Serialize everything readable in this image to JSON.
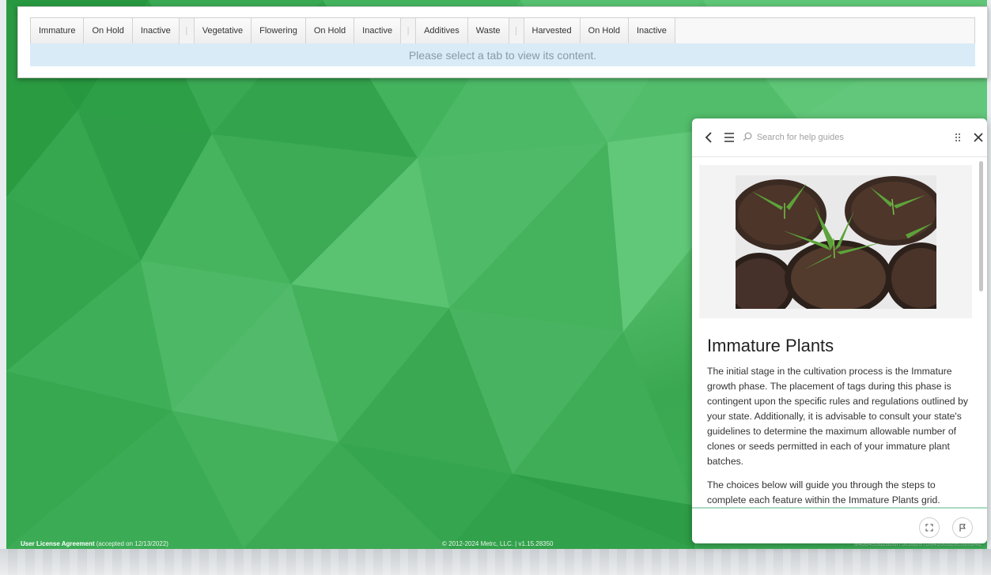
{
  "tabs": {
    "group1": [
      "Immature",
      "On Hold",
      "Inactive"
    ],
    "group2": [
      "Vegetative",
      "Flowering",
      "On Hold",
      "Inactive"
    ],
    "group3": [
      "Additives",
      "Waste"
    ],
    "group4": [
      "Harvested",
      "On Hold",
      "Inactive"
    ],
    "separator": "|"
  },
  "info_message": "Please select a tab to view its content.",
  "footer": {
    "license_link": "User License Agreement",
    "license_note": "(accepted on 12/13/2022)",
    "copyright": "© 2012-2024 Metrc, LLC. | v1.15.28350",
    "hash": "a4d8453d2a0df73cba2e7b64350d2ec0b0b42"
  },
  "help": {
    "search_placeholder": "Search for help guides",
    "title": "Immature Plants",
    "paragraph1": "The initial stage in the cultivation process is the Immature growth phase. The placement of tags during this phase is contingent upon the specific rules and regulations outlined by your state. Additionally, it is advisable to consult your state's guidelines to determine the maximum allowable number of clones or seeds permitted in each of your immature plant batches.",
    "paragraph2": "The choices below will guide you through the steps to complete each feature within the Immature Plants grid."
  },
  "colors": {
    "background_green": "#45b85c",
    "info_bar": "#d9ebf7",
    "accent_line": "#a9d9c3"
  },
  "icons": [
    "back-icon",
    "menu-icon",
    "search-icon",
    "drag-handle-icon",
    "close-icon",
    "expand-icon",
    "flag-icon"
  ]
}
